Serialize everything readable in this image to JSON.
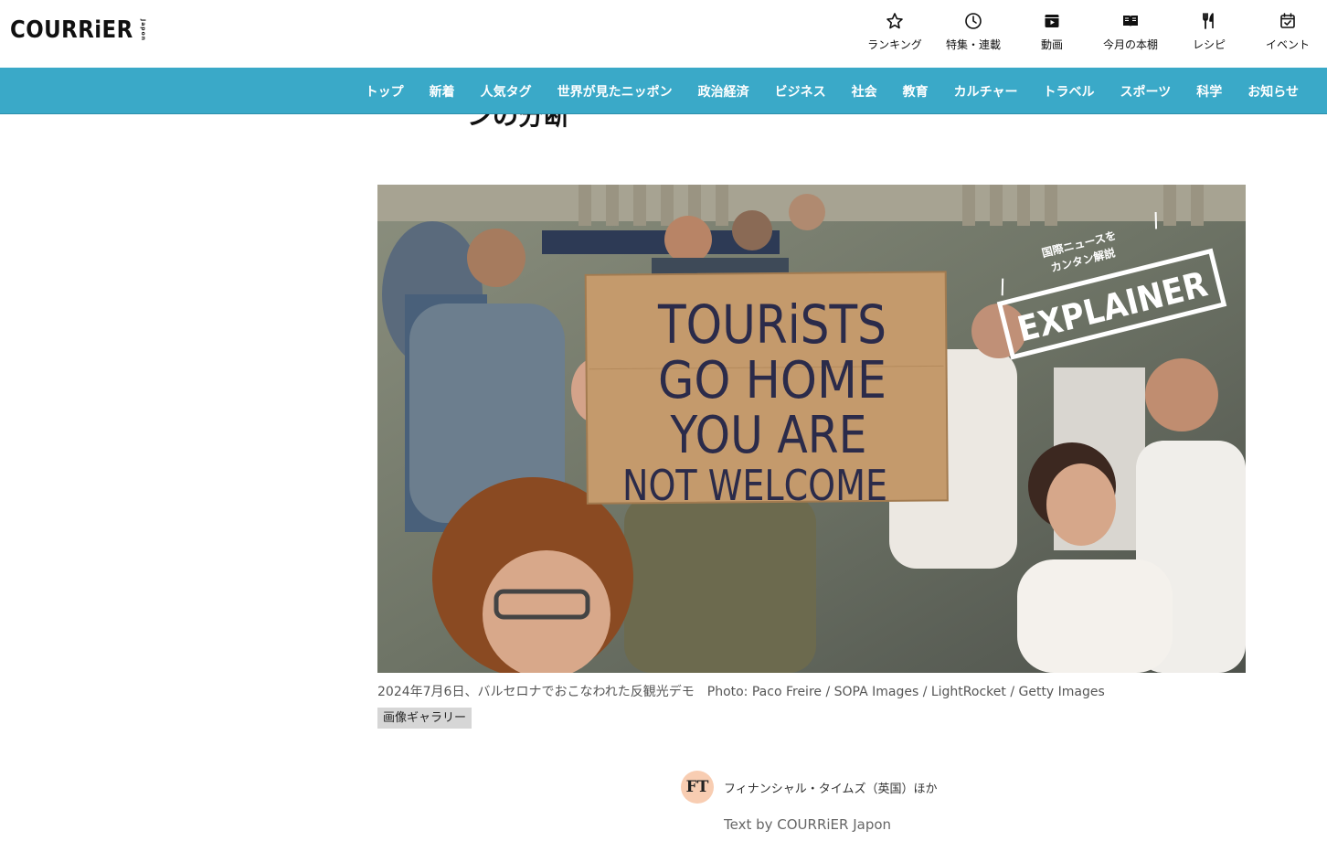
{
  "header": {
    "logo_main": "COURRiER",
    "logo_sub": "Japon",
    "util_nav": [
      {
        "label": "ランキング",
        "icon": "star-icon"
      },
      {
        "label": "特集・連載",
        "icon": "clock-icon"
      },
      {
        "label": "動画",
        "icon": "video-icon"
      },
      {
        "label": "今月の本棚",
        "icon": "book-icon"
      },
      {
        "label": "レシピ",
        "icon": "fork-knife-icon"
      },
      {
        "label": "イベント",
        "icon": "calendar-check-icon"
      }
    ]
  },
  "catnav": {
    "items": [
      "トップ",
      "新着",
      "人気タグ",
      "世界が見たニッポン",
      "政治経済",
      "ビジネス",
      "社会",
      "教育",
      "カルチャー",
      "トラベル",
      "スポーツ",
      "科学",
      "お知らせ"
    ],
    "bg_color": "#3aa9c8"
  },
  "article": {
    "headline_fragment": "ンの分断",
    "hero": {
      "sign_lines": [
        "TOURiSTS",
        "GO HOME",
        "YOU ARE",
        "NOT WELCOME"
      ],
      "badge_top": "国際ニュースを",
      "badge_middle": "カンタン解説",
      "badge_main": "EXPLAINER"
    },
    "caption": "2024年7月6日、バルセロナでおこなわれた反観光デモ",
    "credit": "Photo: Paco Freire / SOPA Images / LightRocket / Getty Images",
    "gallery_label": "画像ギャラリー",
    "source_badge": "FT",
    "source_name": "フィナンシャル・タイムズ（英国）ほか",
    "text_by": "Text by COURRiER Japon"
  }
}
